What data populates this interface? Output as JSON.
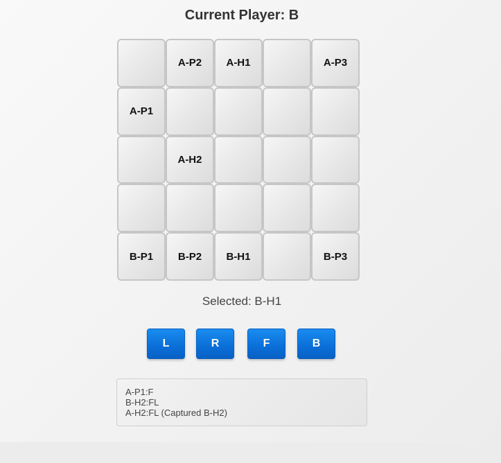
{
  "header": {
    "title": "Current Player: B"
  },
  "board": {
    "rows": [
      [
        "",
        "A-P2",
        "A-H1",
        "",
        "A-P3"
      ],
      [
        "A-P1",
        "",
        "",
        "",
        ""
      ],
      [
        "",
        "A-H2",
        "",
        "",
        ""
      ],
      [
        "",
        "",
        "",
        "",
        ""
      ],
      [
        "B-P1",
        "B-P2",
        "B-H1",
        "",
        "B-P3"
      ]
    ]
  },
  "selection": {
    "text": "Selected: B-H1"
  },
  "controls": {
    "left_label": "L",
    "right_label": "R",
    "forward_label": "F",
    "back_label": "B"
  },
  "move_log": [
    "A-P1:F",
    "B-H2:FL",
    "A-H2:FL (Captured B-H2)"
  ],
  "colors": {
    "button_blue": "#0a6fd8",
    "cell_border": "#c6c6c6"
  }
}
